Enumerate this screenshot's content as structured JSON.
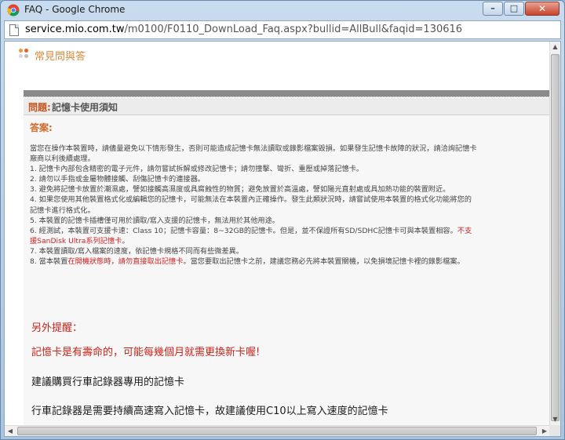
{
  "window": {
    "title": "FAQ - Google Chrome",
    "controls": {
      "minimize": "–",
      "maximize": "□",
      "close": "✕"
    }
  },
  "address": {
    "host": "service.mio.com.tw",
    "path": "/m0100/F0110_DownLoad_Faq.aspx?bullid=AllBull&faqid=130616"
  },
  "page": {
    "heading": "常見問與答",
    "question_label": "問題:",
    "question_title": "記憶卡使用須知",
    "answer_label": "答案:",
    "intro": "當您在操作本裝置時，請儘量避免以下情形發生，否則可能造成記憶卡無法讀取或錄影檔案毀損。如果發生記憶卡故障的狀況，請洽詢記憶卡廠商以利後續處理。",
    "items": [
      "1. 記憶卡內部包含精密的電子元件，請勿嘗試拆解或修改記憶卡；請勿撞擊、彎折、重壓或掉落記憶卡。",
      "2. 請勿以手指或金屬物體接觸、刮傷記憶卡的連接器。",
      "3. 避免將記憶卡放置於潮濕處，譬如接觸高濕度或具腐蝕性的物質；避免放置於高溫處，譬如陽光直射處或具加熱功能的裝置附近。",
      "4. 如果您使用其他裝置格式化或編輯您的記憶卡，可能無法在本裝置內正確操作。發生此類狀況時，請嘗試使用本裝置的格式化功能將您的記憶卡進行格式化。",
      "5. 本裝置的記憶卡插槽僅可用於讀取/寫入支援的記憶卡，無法用於其他用途。"
    ],
    "item6_a": "6. 經測試，本裝置可支援卡速：Class 10；記憶卡容量：8~32GB的記憶卡。但是，並不保證所有SD/SDHC記憶卡可與本裝置相容。",
    "item6_b": "不支援SanDisk Ultra系列記憶卡",
    "item6_c": "。",
    "item7": "7. 本裝置讀取/寫入檔案的速度，依記憶卡規格不同而有些微差異。",
    "item8_a": "8. 當本裝置",
    "item8_b": "在開機狀態時，請勿直接取出記憶卡",
    "item8_c": "。當您要取出記憶卡之前，建議您務必先將本裝置關機，以免損壞記憶卡裡的錄影檔案。",
    "reminder_title": "另外提醒：",
    "reminder_text": "記憶卡是有壽命的，可能每幾個月就需更換新卡喔!",
    "suggest_1": "建議購買行車記錄器專用的記憶卡",
    "suggest_2": "行車記錄器是需要持續高速寫入記憶卡，故建議使用C10以上寫入速度的記憶卡"
  },
  "colors": {
    "heading": "#e08a3a",
    "question_label": "#c8551f",
    "emphasis_red": "#d02020",
    "reminder_red": "#c8241a"
  },
  "icons": {
    "app": "chrome-icon",
    "page": "page-icon",
    "logo": "faq-logo-icon"
  }
}
